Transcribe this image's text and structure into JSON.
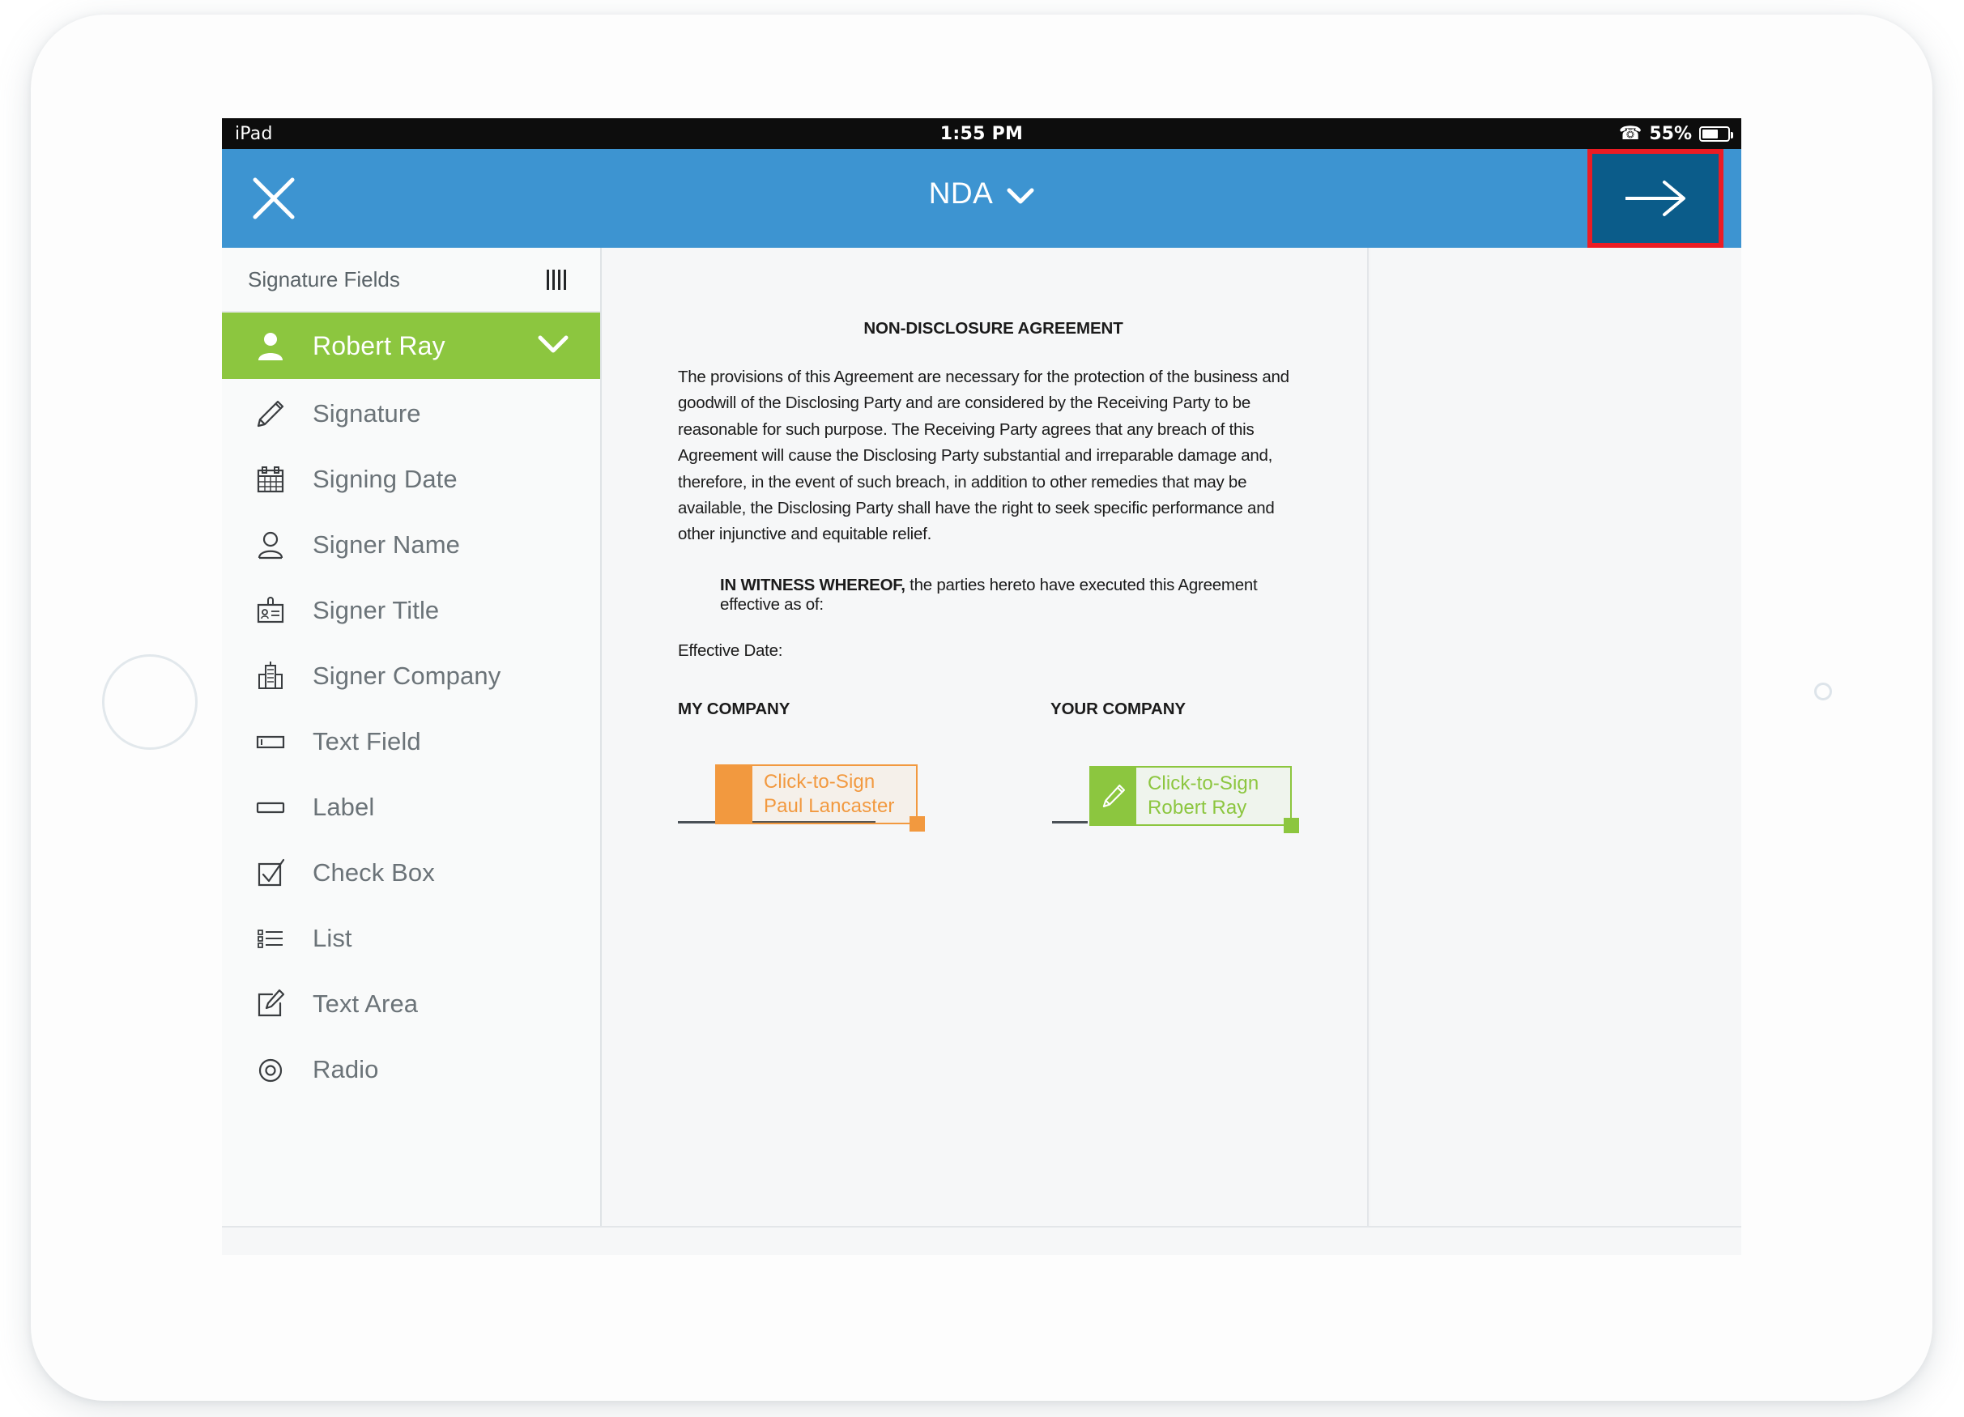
{
  "status_bar": {
    "device_label": "iPad",
    "time": "1:55 PM",
    "bluetooth_icon": "bluetooth-icon",
    "battery_percent": "55%",
    "battery_level": 55
  },
  "header": {
    "close_icon": "close-icon",
    "title": "NDA",
    "title_chevron_icon": "chevron-down-icon",
    "next_icon": "arrow-right-icon",
    "accent_color": "#3d94d1",
    "next_button_color": "#0b5c8a",
    "highlight_color": "#ec1c24"
  },
  "sidebar": {
    "header_title": "Signature Fields",
    "header_icon": "vertical-bars-icon",
    "signer": {
      "name": "Robert Ray",
      "icon": "person-filled-icon",
      "chevron_icon": "chevron-down-icon",
      "color": "#8cc63f"
    },
    "fields": [
      {
        "label": "Signature",
        "icon": "pen-icon"
      },
      {
        "label": "Signing Date",
        "icon": "calendar-icon"
      },
      {
        "label": "Signer Name",
        "icon": "person-outline-icon"
      },
      {
        "label": "Signer Title",
        "icon": "id-badge-icon"
      },
      {
        "label": "Signer Company",
        "icon": "building-icon"
      },
      {
        "label": "Text Field",
        "icon": "text-field-icon"
      },
      {
        "label": "Label",
        "icon": "label-icon"
      },
      {
        "label": "Check Box",
        "icon": "checkbox-icon"
      },
      {
        "label": "List",
        "icon": "list-icon"
      },
      {
        "label": "Text Area",
        "icon": "text-area-icon"
      },
      {
        "label": "Radio",
        "icon": "radio-icon"
      }
    ]
  },
  "document": {
    "title": "NON-DISCLOSURE AGREEMENT",
    "paragraph": "The provisions of this Agreement are necessary for the protection of the business and goodwill of the Disclosing Party and are considered by the Receiving Party to be reasonable for such purpose. The Receiving Party agrees that any breach of this Agreement will cause the Disclosing Party substantial and irreparable damage and, therefore, in the event of such breach, in addition to other remedies that may be available, the Disclosing Party shall have the right to seek specific performance and other injunctive and equitable relief.",
    "witness_bold": "IN WITNESS WHEREOF,",
    "witness_rest": " the parties hereto have executed this Agreement effective as of:",
    "effective_date_label": "Effective Date:",
    "company_my": "MY COMPANY",
    "company_your": "YOUR COMPANY",
    "signature_fields": [
      {
        "id": "orange",
        "action_label": "Click-to-Sign",
        "signer_name": "Paul Lancaster",
        "color": "#f2993f",
        "icon": "blank-icon",
        "handle_icon": "resize-handle-icon"
      },
      {
        "id": "green",
        "action_label": "Click-to-Sign",
        "signer_name": "Robert Ray",
        "color": "#8cc63f",
        "icon": "pen-icon",
        "handle_icon": "resize-handle-icon"
      }
    ]
  }
}
